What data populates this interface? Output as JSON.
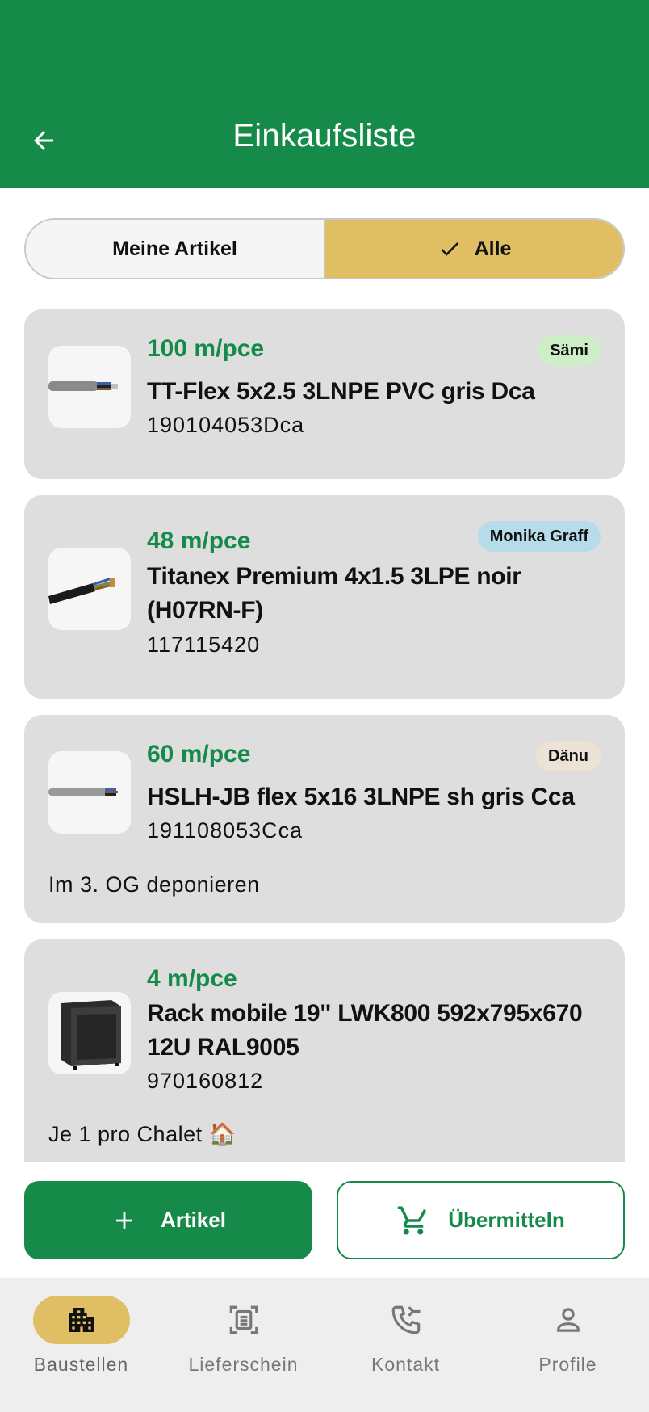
{
  "header": {
    "title": "Einkaufsliste"
  },
  "filter": {
    "mine_label": "Meine Artikel",
    "all_label": "Alle",
    "selected": "Alle"
  },
  "items": [
    {
      "quantity": "100 m/pce",
      "name": "TT-Flex 5x2.5 3LNPE PVC gris Dca",
      "code": "190104053Dca",
      "assignee": "Sämi",
      "assignee_color": "#cdeec6"
    },
    {
      "quantity": "48 m/pce",
      "name": "Titanex Premium 4x1.5 3LPE noir (H07RN-F)",
      "code": "117115420",
      "assignee": "Monika Graff",
      "assignee_color": "#b7dce9"
    },
    {
      "quantity": "60 m/pce",
      "name": "HSLH-JB flex 5x16 3LNPE sh gris Cca",
      "code": "191108053Cca",
      "assignee": "Dänu",
      "assignee_color": "#ece3d6",
      "note": "Im 3. OG deponieren"
    },
    {
      "quantity": "4 m/pce",
      "name": "Rack mobile 19\" LWK800 592x795x670 12U RAL9005",
      "code": "970160812",
      "note": "Je 1 pro Chalet 🏠"
    }
  ],
  "actions": {
    "add_label": "Artikel",
    "submit_label": "Übermitteln"
  },
  "nav": [
    {
      "label": "Baustellen",
      "icon": "buildings-icon",
      "active": true
    },
    {
      "label": "Lieferschein",
      "icon": "document-scan-icon",
      "active": false
    },
    {
      "label": "Kontakt",
      "icon": "phone-forward-icon",
      "active": false
    },
    {
      "label": "Profile",
      "icon": "person-icon",
      "active": false
    }
  ],
  "colors": {
    "brand_green": "#168a48",
    "accent_gold": "#e0be63",
    "card_bg": "#dedede"
  }
}
